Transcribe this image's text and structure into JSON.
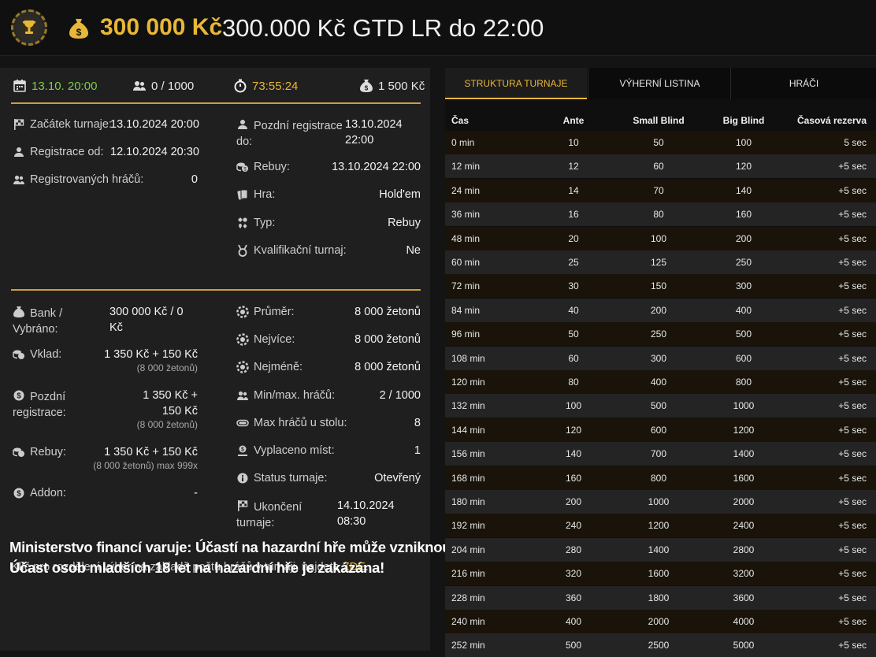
{
  "header": {
    "amount": "300 000 Kč",
    "title": "300.000 Kč GTD LR do 22:00"
  },
  "topbar": {
    "date": "13.10. 20:00",
    "players": "0 / 1000",
    "timer": "73:55:24",
    "buyin": "1 500 Kč"
  },
  "info_left": [
    {
      "label": "Začátek turnaje:",
      "value": "13.10.2024 20:00"
    },
    {
      "label": "Registrace od:",
      "value": "12.10.2024 20:30"
    },
    {
      "label": "Registrovaných hráčů:",
      "value": "0"
    }
  ],
  "info_right": [
    {
      "label": "Pozdní registrace do:",
      "value": "13.10.2024 22:00"
    },
    {
      "label": "Rebuy:",
      "value": "13.10.2024 22:00"
    },
    {
      "label": "Hra:",
      "value": "Hold'em"
    },
    {
      "label": "Typ:",
      "value": "Rebuy"
    },
    {
      "label": "Kvalifikační turnaj:",
      "value": "Ne"
    }
  ],
  "money_left": [
    {
      "label": "Bank / Vybráno:",
      "value": "300 000 Kč / 0 Kč",
      "sub": ""
    },
    {
      "label": "Vklad:",
      "value": "1 350 Kč + 150 Kč",
      "sub": "(8 000 žetonů)"
    },
    {
      "label": "Pozdní registrace:",
      "value": "1 350 Kč + 150 Kč",
      "sub": "(8 000 žetonů)"
    },
    {
      "label": "Rebuy:",
      "value": "1 350 Kč + 150 Kč",
      "sub": "(8 000 žetonů) max 999x"
    },
    {
      "label": "Addon:",
      "value": "-",
      "sub": ""
    }
  ],
  "money_right": [
    {
      "label": "Průměr:",
      "value": "8 000 žetonů"
    },
    {
      "label": "Nejvíce:",
      "value": "8 000 žetonů"
    },
    {
      "label": "Nejméně:",
      "value": "8 000 žetonů"
    },
    {
      "label": "Min/max. hráčů:",
      "value": "2 / 1000"
    },
    {
      "label": "Max hráčů u stolu:",
      "value": "8"
    },
    {
      "label": "Vyplaceno míst:",
      "value": "1"
    },
    {
      "label": "Status turnaje:",
      "value": "Otevřený"
    },
    {
      "label": "Ukončení turnaje:",
      "value": "14.10.2024 08:30"
    }
  ],
  "note": {
    "text": "Klíč pro rozdělení výher na základě počtu hráčů v turnaji, najdete ",
    "link": "ZDE",
    "end": "."
  },
  "warning": {
    "line1": "Ministerstvo financí varuje: Účastí na hazardní hře může vzniknout závislost!",
    "line2": "Účast osob mladších 18 let na hazardní hře je zakázána!"
  },
  "tabs": [
    "STRUKTURA TURNAJE",
    "VÝHERNÍ LISTINA",
    "HRÁČI"
  ],
  "table": {
    "headers": [
      "Čas",
      "Ante",
      "Small Blind",
      "Big Blind",
      "Časová rezerva"
    ],
    "rows": [
      [
        "0 min",
        "10",
        "50",
        "100",
        "5 sec"
      ],
      [
        "12 min",
        "12",
        "60",
        "120",
        "+5 sec"
      ],
      [
        "24 min",
        "14",
        "70",
        "140",
        "+5 sec"
      ],
      [
        "36 min",
        "16",
        "80",
        "160",
        "+5 sec"
      ],
      [
        "48 min",
        "20",
        "100",
        "200",
        "+5 sec"
      ],
      [
        "60 min",
        "25",
        "125",
        "250",
        "+5 sec"
      ],
      [
        "72 min",
        "30",
        "150",
        "300",
        "+5 sec"
      ],
      [
        "84 min",
        "40",
        "200",
        "400",
        "+5 sec"
      ],
      [
        "96 min",
        "50",
        "250",
        "500",
        "+5 sec"
      ],
      [
        "108 min",
        "60",
        "300",
        "600",
        "+5 sec"
      ],
      [
        "120 min",
        "80",
        "400",
        "800",
        "+5 sec"
      ],
      [
        "132 min",
        "100",
        "500",
        "1000",
        "+5 sec"
      ],
      [
        "144 min",
        "120",
        "600",
        "1200",
        "+5 sec"
      ],
      [
        "156 min",
        "140",
        "700",
        "1400",
        "+5 sec"
      ],
      [
        "168 min",
        "160",
        "800",
        "1600",
        "+5 sec"
      ],
      [
        "180 min",
        "200",
        "1000",
        "2000",
        "+5 sec"
      ],
      [
        "192 min",
        "240",
        "1200",
        "2400",
        "+5 sec"
      ],
      [
        "204 min",
        "280",
        "1400",
        "2800",
        "+5 sec"
      ],
      [
        "216 min",
        "320",
        "1600",
        "3200",
        "+5 sec"
      ],
      [
        "228 min",
        "360",
        "1800",
        "3600",
        "+5 sec"
      ],
      [
        "240 min",
        "400",
        "2000",
        "4000",
        "+5 sec"
      ],
      [
        "252 min",
        "500",
        "2500",
        "5000",
        "+5 sec"
      ]
    ]
  }
}
